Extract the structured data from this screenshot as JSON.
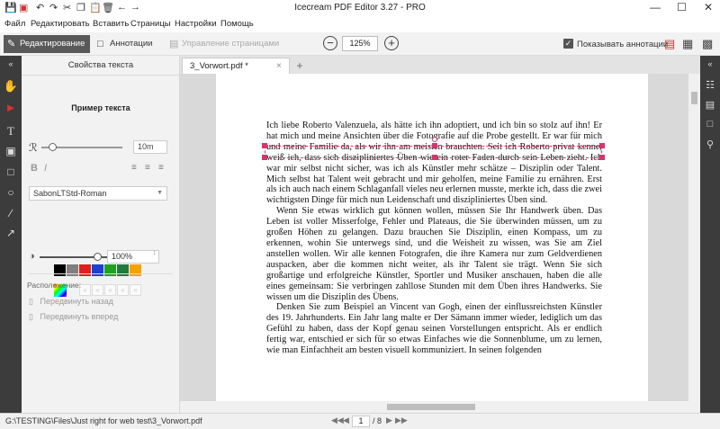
{
  "app": {
    "title": "Icecream PDF Editor 3.27 - PRO",
    "quick_access": [
      "save-icon",
      "pdf-icon",
      "undo-icon",
      "redo-icon",
      "cut-icon",
      "copy-icon",
      "paste-icon",
      "delete-icon",
      "back-icon",
      "forward-icon"
    ],
    "window_controls": {
      "minimize": "—",
      "maximize": "☐",
      "close": "✕"
    }
  },
  "menu": [
    "Файл",
    "Редактировать",
    "Вставить",
    "Страницы",
    "Настройки",
    "Помощь"
  ],
  "modes": {
    "edit": "Редактирование",
    "annotations": "Аннотации",
    "pages": "Управление страницами"
  },
  "zoom": {
    "minus": "−",
    "value": "125%",
    "plus": "+"
  },
  "show_annotations": {
    "label": "Показывать аннотации",
    "checked": true
  },
  "properties": {
    "header": "Свойства текста",
    "sample": "Пример текста",
    "font_size": "10m",
    "bold": "B",
    "italic": "I",
    "font": "SabonLTStd-Roman",
    "colors": [
      "#000000",
      "#808080",
      "#e02020",
      "#1e3fd0",
      "#20a020",
      "#207a40",
      "#f5a200"
    ],
    "opacity": "100%",
    "arrange_label": "Расположение:",
    "move_back": "Передвинуть назад",
    "move_forward": "Передвинуть вперед"
  },
  "tab": {
    "name": "3_Vorwort.pdf *",
    "close": "×",
    "add": "+"
  },
  "document": {
    "paragraphs": [
      "Ich liebe Roberto Valenzuela, als hätte ich ihn adoptiert, und ich bin so stolz auf ihn! Er hat mich und meine Ansichten über die Fotografie auf die Probe gestellt. Er war für mich und meine Familie da, als wir ihn am meisten brauchten. Seit ich Roberto privat kenne, weiß ich, dass sich diszipliniertes Üben wie ein roter Faden durch sein Leben zieht. Ich war mir selbst nicht sicher, was ich als Künstler mehr schätze – Disziplin oder Talent. Mich selbst hat Talent weit gebracht und mir geholfen, meine Familie zu ernähren. Erst als ich auch nach einem Schlaganfall vieles neu erlernen musste, merkte ich, dass die zwei wichtigsten Dinge für mich nun Leidenschaft und diszipliniertes Üben sind.",
      "Wenn Sie etwas wirklich gut können wollen, müssen Sie Ihr Handwerk üben. Das Leben ist voller Misserfolge, Fehler und Plateaus, die Sie überwinden müssen, um zu großen Höhen zu gelangen. Dazu brauchen Sie Disziplin, einen Kompass, um zu erkennen, wohin Sie unterwegs sind, und die Weisheit zu wissen, was Sie am Ziel anstellen wollen. Wir alle kennen Fotografen, die ihre Kamera nur zum Geldverdienen auspacken, aber die kommen nicht weiter, als ihr Talent sie trägt. Wenn Sie sich großartige und erfolgreiche Künstler, Sportler und Musiker anschauen, haben die alle eines gemeinsam: Sie verbringen zahllose Stunden mit dem Üben ihres Handwerks. Sie wissen um die Disziplin des Übens.",
      "Denken Sie zum Beispiel an Vincent van Gogh, einen der einflussreichsten Künstler des 19. Jahrhunderts. Ein Jahr lang malte er Der Sämann immer wieder, lediglich um das Gefühl zu haben, dass der Kopf genau seinen Vorstellungen entspricht. Als er endlich fertig war, entschied er sich für so etwas Einfaches wie die Sonnenblume, um zu lernen, wie man Einfachheit am besten visuell kommuniziert. In seinen folgenden"
    ]
  },
  "status": {
    "path": "G:\\TESTING\\Files\\Just right for web test\\3_Vorwort.pdf",
    "page": "1",
    "total": "/ 8"
  }
}
